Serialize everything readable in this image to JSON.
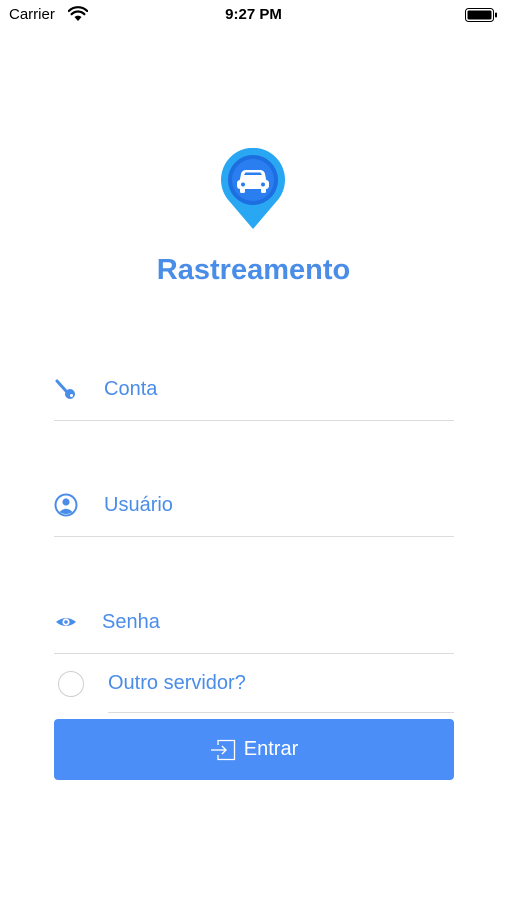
{
  "status_bar": {
    "carrier": "Carrier",
    "time": "9:27 PM"
  },
  "app": {
    "title": "Rastreamento",
    "logo_icon": "car-location-pin-icon",
    "accent_color": "#4a8de8"
  },
  "form": {
    "account": {
      "icon": "key-icon",
      "placeholder": "Conta",
      "value": ""
    },
    "user": {
      "icon": "user-icon",
      "placeholder": "Usuário",
      "value": ""
    },
    "password": {
      "icon": "eye-icon",
      "placeholder": "Senha",
      "value": ""
    },
    "other_server": {
      "label": "Outro servidor?",
      "checked": false
    },
    "login_button": {
      "label": "Entrar",
      "icon": "login-icon",
      "color": "#4b8ef8"
    }
  }
}
